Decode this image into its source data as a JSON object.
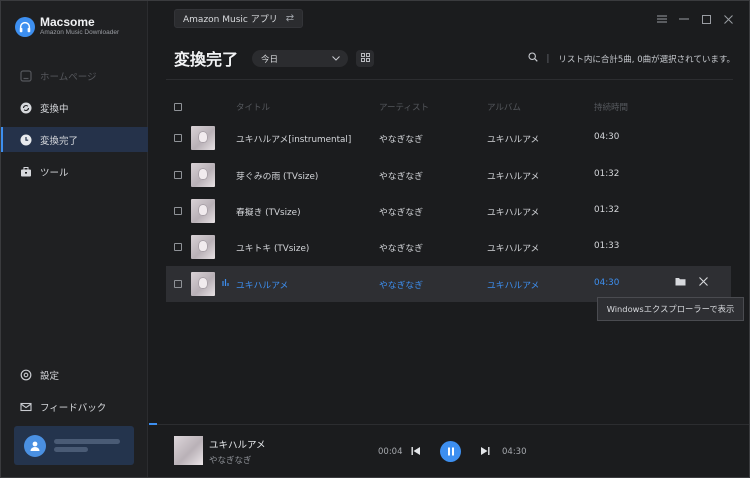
{
  "app": {
    "name": "Macsome",
    "subtitle": "Amazon Music Downloader",
    "source_button": "Amazon Music アプリ"
  },
  "colors": {
    "accent": "#3d8ff0",
    "background": "#1b1c1e",
    "sidebar": "#1f2022",
    "active_nav": "#25324a"
  },
  "sidebar": {
    "items": [
      {
        "label": "ホームページ",
        "icon": "home-icon",
        "state": "disabled"
      },
      {
        "label": "変換中",
        "icon": "converting-icon",
        "state": "normal"
      },
      {
        "label": "変換完了",
        "icon": "clock-icon",
        "state": "active"
      },
      {
        "label": "ツール",
        "icon": "toolbox-icon",
        "state": "normal"
      }
    ],
    "bottom_items": [
      {
        "label": "設定",
        "icon": "gear-icon"
      },
      {
        "label": "フィードバック",
        "icon": "mail-icon"
      }
    ]
  },
  "header": {
    "title": "変換完了",
    "date_filter": "今日",
    "status": "リスト内に合計5曲, 0曲が選択されています。"
  },
  "table": {
    "columns": [
      "タイトル",
      "アーティスト",
      "アルバム",
      "持続時間"
    ],
    "rows": [
      {
        "title": "ユキハルアメ[instrumental]",
        "artist": "やなぎなぎ",
        "album": "ユキハルアメ",
        "duration": "04:30"
      },
      {
        "title": "芽ぐみの雨 (TVsize)",
        "artist": "やなぎなぎ",
        "album": "ユキハルアメ",
        "duration": "01:32"
      },
      {
        "title": "春擬き (TVsize)",
        "artist": "やなぎなぎ",
        "album": "ユキハルアメ",
        "duration": "01:32"
      },
      {
        "title": "ユキトキ (TVsize)",
        "artist": "やなぎなぎ",
        "album": "ユキハルアメ",
        "duration": "01:33"
      },
      {
        "title": "ユキハルアメ",
        "artist": "やなぎなぎ",
        "album": "ユキハルアメ",
        "duration": "04:30"
      }
    ],
    "tooltip": "Windowsエクスプローラーで表示"
  },
  "player": {
    "title": "ユキハルアメ",
    "artist": "やなぎなぎ",
    "current_time": "00:04",
    "total_time": "04:30"
  }
}
